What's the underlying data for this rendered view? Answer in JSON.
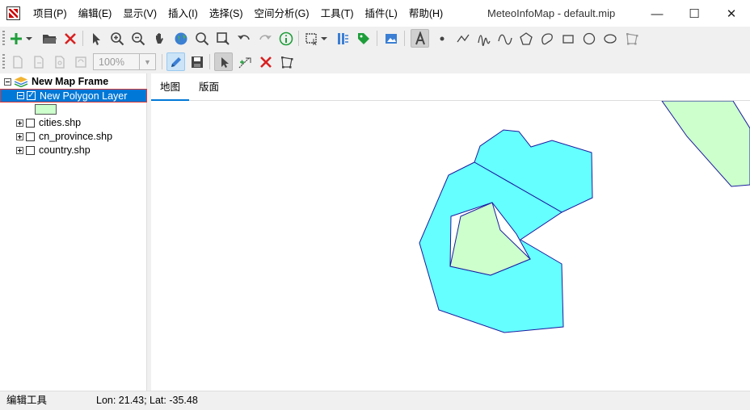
{
  "window": {
    "title": "MeteoInfoMap - default.mip",
    "minimize": "—",
    "maximize": "☐",
    "close": "✕"
  },
  "menu": [
    "项目(P)",
    "编辑(E)",
    "显示(V)",
    "插入(I)",
    "选择(S)",
    "空间分析(G)",
    "工具(T)",
    "插件(L)",
    "帮助(H)"
  ],
  "toolbar2": {
    "zoom_value": "100%"
  },
  "tree": {
    "frame_label": "New Map Frame",
    "layers": [
      {
        "label": "New Polygon Layer",
        "checked": true,
        "selected": true
      },
      {
        "label": "cities.shp",
        "checked": false
      },
      {
        "label": "cn_province.shp",
        "checked": false
      },
      {
        "label": "country.shp",
        "checked": false
      }
    ]
  },
  "tabs": [
    {
      "label": "地图",
      "active": true
    },
    {
      "label": "版面",
      "active": false
    }
  ],
  "colors": {
    "polygon_cyan": "#66ffff",
    "polygon_green": "#ccffcc",
    "polygon_stroke": "#1a1aa0",
    "accent": "#0078d7"
  },
  "status": {
    "tool": "编辑工具",
    "coords": "Lon: 21.43; Lat: -35.48"
  }
}
